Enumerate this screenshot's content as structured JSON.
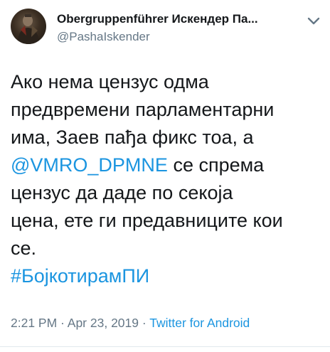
{
  "tweet": {
    "display_name": "Obergruppenführer Искендер Па...",
    "handle": "@PashaIskender",
    "body": {
      "line1": "Ако нема цензус одма",
      "line2": "предвремени парламентарни",
      "line3": "има, Заев пађа фикс тоа, а",
      "mention": "@VMRO_DPMNE",
      "line4_rest": " се спрема",
      "line5": "цензус да даде по секоја",
      "line6": "цена, ете ги предавниците кои",
      "line7": "се.",
      "hashtag": "#БојкотирамПИ"
    },
    "time": "2:21 PM",
    "separator1": " · ",
    "date": "Apr 23, 2019",
    "separator2": " · ",
    "source": "Twitter for Android"
  },
  "icons": {
    "avatar": "profile-photo",
    "menu": "chevron-down-icon"
  },
  "colors": {
    "link": "#1b95e0",
    "text": "#14171a",
    "muted": "#657786",
    "divider": "#e1e8ed"
  }
}
